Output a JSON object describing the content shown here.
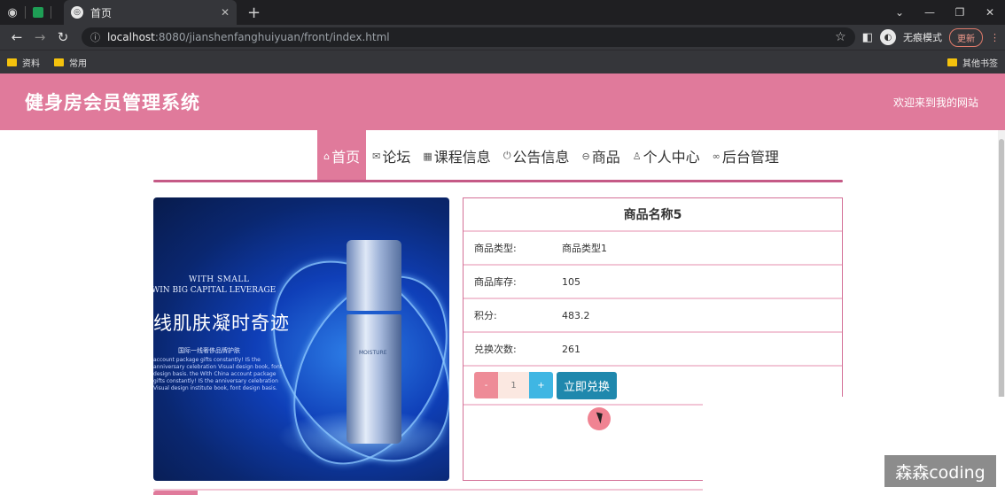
{
  "browser": {
    "tab_title": "首页",
    "url_host": "localhost",
    "url_path": ":8080/jianshenfanghuiyuan/front/index.html",
    "incognito_label": "无痕模式",
    "update_label": "更新",
    "bookmarks": [
      "资料",
      "常用"
    ],
    "other_bookmarks": "其他书签"
  },
  "site": {
    "title": "健身房会员管理系统",
    "welcome": "欢迎来到我的网站"
  },
  "menu": [
    {
      "label": "首页",
      "icon": "home-icon",
      "glyph": "⌂"
    },
    {
      "label": "论坛",
      "icon": "mail-icon",
      "glyph": "✉"
    },
    {
      "label": "课程信息",
      "icon": "calendar-icon",
      "glyph": "▦"
    },
    {
      "label": "公告信息",
      "icon": "power-icon",
      "glyph": "⏻"
    },
    {
      "label": "商品",
      "icon": "product-icon",
      "glyph": "⊖"
    },
    {
      "label": "个人中心",
      "icon": "user-icon",
      "glyph": "♙"
    },
    {
      "label": "后台管理",
      "icon": "link-icon",
      "glyph": "∞"
    }
  ],
  "product_image": {
    "line1": "WITH SMALL",
    "line2": "WIN BIG CAPITAL LEVERAGE",
    "line3": "线肌肤凝时奇迹",
    "line4": "国际一线奢侈品牌护肤",
    "line5": "account package gifts constantly! IS the anniversary celebration Visual design book, font design basis. the With China account package gifts constantly! IS the anniversary celebration Visual design institute book, font design basis.",
    "bottle_label": "MOISTURE"
  },
  "detail": {
    "title": "商品名称5",
    "rows": [
      {
        "label": "商品类型:",
        "value": "商品类型1"
      },
      {
        "label": "商品库存:",
        "value": "105"
      },
      {
        "label": "积分:",
        "value": "483.2"
      },
      {
        "label": "兑换次数:",
        "value": "261"
      }
    ],
    "qty_minus": "-",
    "qty_value": "1",
    "qty_plus": "+",
    "buy_label": "立即兑换"
  },
  "watermark": "森森coding"
}
